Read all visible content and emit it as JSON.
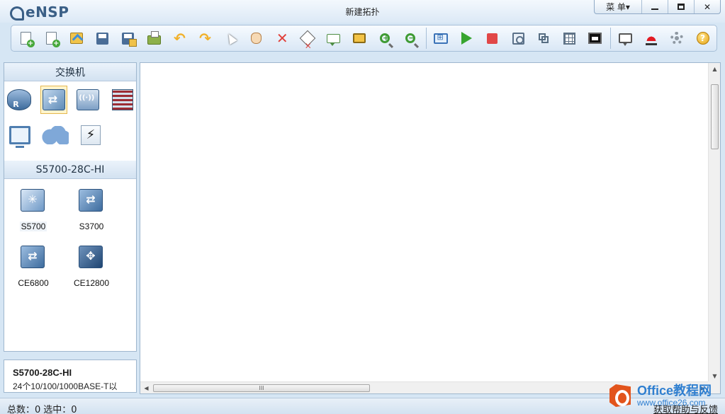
{
  "app": {
    "logo_text": "eNSP",
    "window_title": "新建拓扑",
    "menu_label": "菜 单▾"
  },
  "toolbar": {
    "buttons": [
      {
        "name": "new-topology",
        "icon": "new-doc-icon"
      },
      {
        "name": "new-lab",
        "icon": "new-page-icon"
      },
      {
        "name": "open",
        "icon": "open-icon"
      },
      {
        "name": "save",
        "icon": "save-icon"
      },
      {
        "name": "save-as",
        "icon": "save-as-icon"
      },
      {
        "name": "print",
        "icon": "print-icon"
      },
      {
        "name": "undo",
        "icon": "undo-icon"
      },
      {
        "name": "redo",
        "icon": "redo-icon"
      },
      {
        "name": "select",
        "icon": "cursor-icon"
      },
      {
        "name": "drag",
        "icon": "hand-icon"
      },
      {
        "name": "delete",
        "icon": "delete-icon"
      },
      {
        "name": "delete-all-links",
        "icon": "eraser-icon"
      },
      {
        "name": "add-note",
        "icon": "note-icon"
      },
      {
        "name": "add-rectangle",
        "icon": "rectangle-icon"
      },
      {
        "name": "zoom-in",
        "icon": "zoom-in-icon"
      },
      {
        "name": "zoom-out",
        "icon": "zoom-out-icon"
      },
      {
        "name": "fit",
        "icon": "fit-icon"
      },
      {
        "name": "start-device",
        "icon": "play-icon"
      },
      {
        "name": "stop-device",
        "icon": "stop-icon"
      },
      {
        "name": "capture",
        "icon": "capture-icon"
      },
      {
        "name": "topology",
        "icon": "topology-icon"
      },
      {
        "name": "grid",
        "icon": "grid-icon"
      },
      {
        "name": "console",
        "icon": "screen-icon"
      },
      {
        "name": "forum",
        "icon": "chat-icon"
      },
      {
        "name": "huawei-site",
        "icon": "huawei-icon"
      },
      {
        "name": "settings",
        "icon": "gear-icon"
      },
      {
        "name": "help",
        "icon": "help-icon"
      }
    ]
  },
  "left_panel": {
    "category_title": "交换机",
    "categories": [
      {
        "name": "router",
        "icon": "router-icon"
      },
      {
        "name": "switch",
        "icon": "switch-icon",
        "selected": true
      },
      {
        "name": "wlan",
        "icon": "wlan-icon"
      },
      {
        "name": "firewall",
        "icon": "firewall-icon"
      },
      {
        "name": "terminal",
        "icon": "pc-icon"
      },
      {
        "name": "cloud",
        "icon": "cloud-icon"
      },
      {
        "name": "cable",
        "icon": "cable-icon"
      }
    ],
    "model_title": "S5700-28C-HI",
    "devices": [
      {
        "label": "S5700",
        "icon": "s5700-icon",
        "selected": true
      },
      {
        "label": "S3700",
        "icon": "s3700-icon"
      },
      {
        "label": "CE6800",
        "icon": "ce6800-icon"
      },
      {
        "label": "CE12800",
        "icon": "ce12800-icon"
      }
    ]
  },
  "info": {
    "title": "S5700-28C-HI",
    "desc": "24个10/100/1000BASE-T以"
  },
  "canvas": {
    "hscroll_grip": "III"
  },
  "status": {
    "total_label": "总数：0",
    "selected_label": "选中：0",
    "help_link": "获取帮助与反馈"
  },
  "watermark": {
    "brand": "Office教程网",
    "url": "www.office26.com"
  },
  "colors": {
    "accent": "#3a5f86",
    "panel_header": "#d3e2f1",
    "selection": "#fff4cc"
  }
}
